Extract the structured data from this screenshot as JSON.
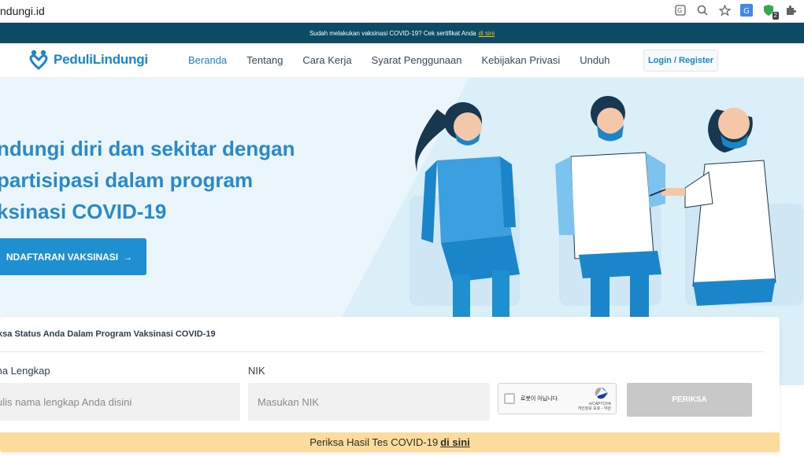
{
  "browser": {
    "url": "ndungi.id",
    "extension_badge": "2"
  },
  "banner": {
    "text": "Sudah melakukan vaksinasi COVID-19? Cek sertifikat Anda",
    "link": "di sini"
  },
  "nav": {
    "logo_text": "PeduliLindungi",
    "links": [
      "Beranda",
      "Tentang",
      "Cara Kerja",
      "Syarat Penggunaan",
      "Kebijakan Privasi",
      "Unduh"
    ],
    "active_index": 0,
    "login_label": "Login / Register"
  },
  "hero": {
    "title_lines": [
      "ndungi diri dan sekitar dengan",
      "partisipasi dalam program",
      "ksinasi COVID-19"
    ],
    "cta_label": "NDAFTARAN VAKSINASI",
    "cta_arrow": "→"
  },
  "check": {
    "title": "iksa Status Anda Dalam Program Vaksinasi COVID-19",
    "name_label": "ma Lengkap",
    "name_placeholder": "ulis nama lengkap Anda disini",
    "nik_label": "NIK",
    "nik_placeholder": "Masukan NIK",
    "recaptcha_text": "로봇이 아닙니다.",
    "recaptcha_brand": "reCAPTCHA",
    "recaptcha_links": "개인정보 보호 - 약관",
    "submit_label": "PERIKSA",
    "footer_text": "Periksa Hasil Tes COVID-19",
    "footer_link": "di sini"
  },
  "colors": {
    "brand": "#1a85c9",
    "banner_bg": "#0d4a64",
    "hero_bg": "#dbeff9",
    "footer_bg": "#fcdc9c"
  }
}
